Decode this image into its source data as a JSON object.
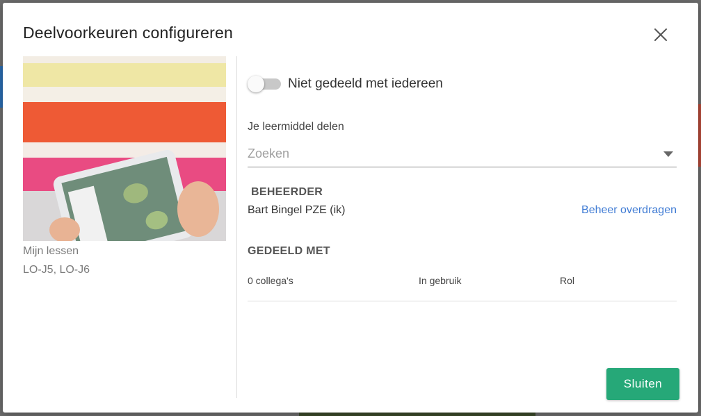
{
  "modal": {
    "title": "Deelvoorkeuren configureren",
    "close_icon": "close-icon"
  },
  "course": {
    "name": "Mijn lessen",
    "groups": "LO-J5, LO-J6"
  },
  "sharing": {
    "toggle_label": "Niet gedeeld met iedereen",
    "toggle_on": false,
    "share_label": "Je leermiddel delen",
    "search_placeholder": "Zoeken",
    "search_value": ""
  },
  "admin": {
    "heading": "BEHEERDER",
    "name": "Bart Bingel PZE (ik)",
    "transfer_link": "Beheer overdragen"
  },
  "shared": {
    "heading": "GEDEELD MET",
    "columns": [
      "0 collega's",
      "In gebruik",
      "Rol"
    ]
  },
  "footer": {
    "close_label": "Sluiten"
  },
  "colors": {
    "accent": "#26a878",
    "link": "#3f7bd4"
  }
}
